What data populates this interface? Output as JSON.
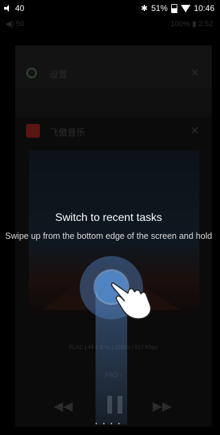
{
  "status_bar": {
    "volume": "40",
    "battery_percent": "51%",
    "time": "10:46"
  },
  "background_status": {
    "volume": "50",
    "battery": "100%",
    "time": "2:52"
  },
  "recent_cards": {
    "settings_title": "设置",
    "app_title": "飞傲音乐",
    "close_glyph": "✕",
    "track_meta": "FLAC | 44.1 KHz | 16Bits | 917 Kbps",
    "brand_label": "FiiO ›",
    "prev_glyph": "◀◀",
    "next_glyph": "▶▶"
  },
  "tutorial": {
    "title": "Switch to recent tasks",
    "subtitle": "Swipe up from the bottom edge of the screen and hold"
  },
  "pager": {
    "dots": "• • • •",
    "active_index": 2
  }
}
